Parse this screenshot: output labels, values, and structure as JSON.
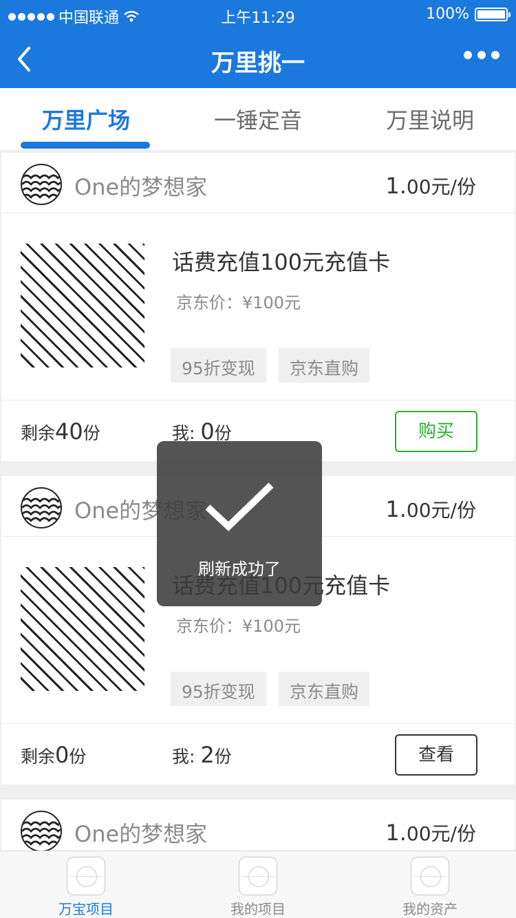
{
  "status_bar": {
    "carrier": "中国联通",
    "time": "上午11:29",
    "battery": "100%"
  },
  "nav": {
    "title": "万里挑一"
  },
  "tabs": [
    {
      "label": "万里广场",
      "active": true
    },
    {
      "label": "一锤定音",
      "active": false
    },
    {
      "label": "万里说明",
      "active": false
    }
  ],
  "cards": [
    {
      "seller": "One的梦想家",
      "price_int": "1.",
      "price_rest": "00元/份",
      "product": "话费充值100元充值卡",
      "jd_price": "京东价：¥100元",
      "tags": [
        "95折变现",
        "京东直购"
      ],
      "remain_prefix": "剩余",
      "remain_num": "40",
      "remain_suffix": "份",
      "mine_prefix": "我: ",
      "mine_num": "0",
      "mine_suffix": "份",
      "button": "购买"
    },
    {
      "seller": "One的梦想家",
      "price_int": "1.",
      "price_rest": "00元/份",
      "product": "话费充值100元充值卡",
      "jd_price": "京东价：¥100元",
      "tags": [
        "95折变现",
        "京东直购"
      ],
      "remain_prefix": "剩余",
      "remain_num": "0",
      "remain_suffix": "份",
      "mine_prefix": "我: ",
      "mine_num": "2",
      "mine_suffix": "份",
      "button": "查看"
    },
    {
      "seller": "One的梦想家",
      "price_int": "1.",
      "price_rest": "00元/份"
    }
  ],
  "toast": {
    "message": "刷新成功了"
  },
  "tabbar": [
    {
      "label": "万宝项目",
      "active": true
    },
    {
      "label": "我的项目",
      "active": false
    },
    {
      "label": "我的资产",
      "active": false
    }
  ],
  "colors": {
    "primary": "#1b78dd",
    "buy": "#2aae2a"
  }
}
